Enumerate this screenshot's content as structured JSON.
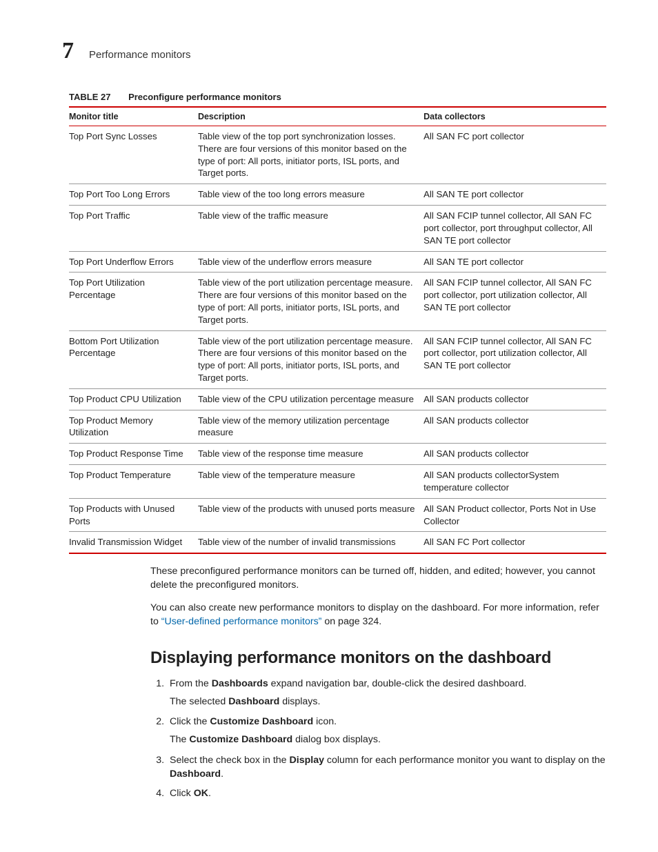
{
  "header": {
    "chapter_number": "7",
    "chapter_title": "Performance monitors"
  },
  "table": {
    "label": "TABLE 27",
    "caption": "Preconfigure performance monitors",
    "cols": [
      "Monitor title",
      "Description",
      "Data collectors"
    ],
    "rows": [
      {
        "title": "Top Port Sync Losses",
        "desc": "Table view of the top port synchronization losses. There are four versions of this monitor based on the type of port: All ports, initiator ports, ISL ports, and Target ports.",
        "coll": "All SAN FC port collector"
      },
      {
        "title": "Top Port Too Long Errors",
        "desc": "Table view of the too long errors measure",
        "coll": "All SAN TE port collector"
      },
      {
        "title": "Top Port Traffic",
        "desc": "Table view of the traffic measure",
        "coll": "All SAN FCIP tunnel collector, All SAN FC port collector, port throughput collector, All SAN TE port collector"
      },
      {
        "title": "Top Port Underflow Errors",
        "desc": "Table view of the underflow errors measure",
        "coll": "All SAN TE port collector"
      },
      {
        "title": "Top Port Utilization Percentage",
        "desc": "Table view of the port utilization percentage measure. There are four versions of this monitor based on the type of port: All ports, initiator ports, ISL ports, and Target ports.",
        "coll": "All SAN FCIP tunnel collector, All SAN FC port collector, port utilization collector, All SAN TE port collector"
      },
      {
        "title": "Bottom Port Utilization Percentage",
        "desc": "Table view of the port utilization percentage measure. There are four versions of this monitor based on the type of port: All ports, initiator ports, ISL ports, and Target ports.",
        "coll": "All SAN FCIP tunnel collector, All SAN FC port collector, port utilization collector, All SAN TE port collector"
      },
      {
        "title": "Top Product CPU Utilization",
        "desc": "Table view of the CPU utilization percentage measure",
        "coll": "All SAN products collector"
      },
      {
        "title": "Top Product Memory Utilization",
        "desc": "Table view of the memory utilization percentage measure",
        "coll": "All SAN products collector"
      },
      {
        "title": "Top Product Response Time",
        "desc": "Table view of the response time measure",
        "coll": "All SAN products collector"
      },
      {
        "title": "Top Product Temperature",
        "desc": "Table view of the temperature measure",
        "coll": "All SAN products collectorSystem temperature collector"
      },
      {
        "title": "Top Products with Unused Ports",
        "desc": "Table view of the products with unused ports measure",
        "coll": "All SAN Product collector, Ports Not in Use Collector"
      },
      {
        "title": "Invalid Transmission Widget",
        "desc": "Table view of the number of invalid transmissions",
        "coll": "All SAN FC Port collector"
      }
    ]
  },
  "para1": "These preconfigured performance monitors can be turned off, hidden, and edited; however, you cannot delete the preconfigured monitors.",
  "para2_pre": "You can also create new performance monitors to display on the dashboard. For more information, refer to ",
  "para2_link": "“User-defined performance monitors”",
  "para2_post": " on page 324.",
  "section_heading": "Displaying performance monitors on the dashboard",
  "steps": {
    "s1_a": "From the ",
    "s1_b": "Dashboards",
    "s1_c": " expand navigation bar, double-click the desired dashboard.",
    "s1_sub_a": "The selected ",
    "s1_sub_b": "Dashboard",
    "s1_sub_c": " displays.",
    "s2_a": "Click the ",
    "s2_b": "Customize Dashboard",
    "s2_c": " icon.",
    "s2_sub_a": "The ",
    "s2_sub_b": "Customize Dashboard",
    "s2_sub_c": " dialog box displays.",
    "s3_a": "Select the check box in the ",
    "s3_b": "Display",
    "s3_c": " column for each performance monitor you want to display on the ",
    "s3_d": "Dashboard",
    "s3_e": ".",
    "s4_a": "Click ",
    "s4_b": "OK",
    "s4_c": "."
  }
}
